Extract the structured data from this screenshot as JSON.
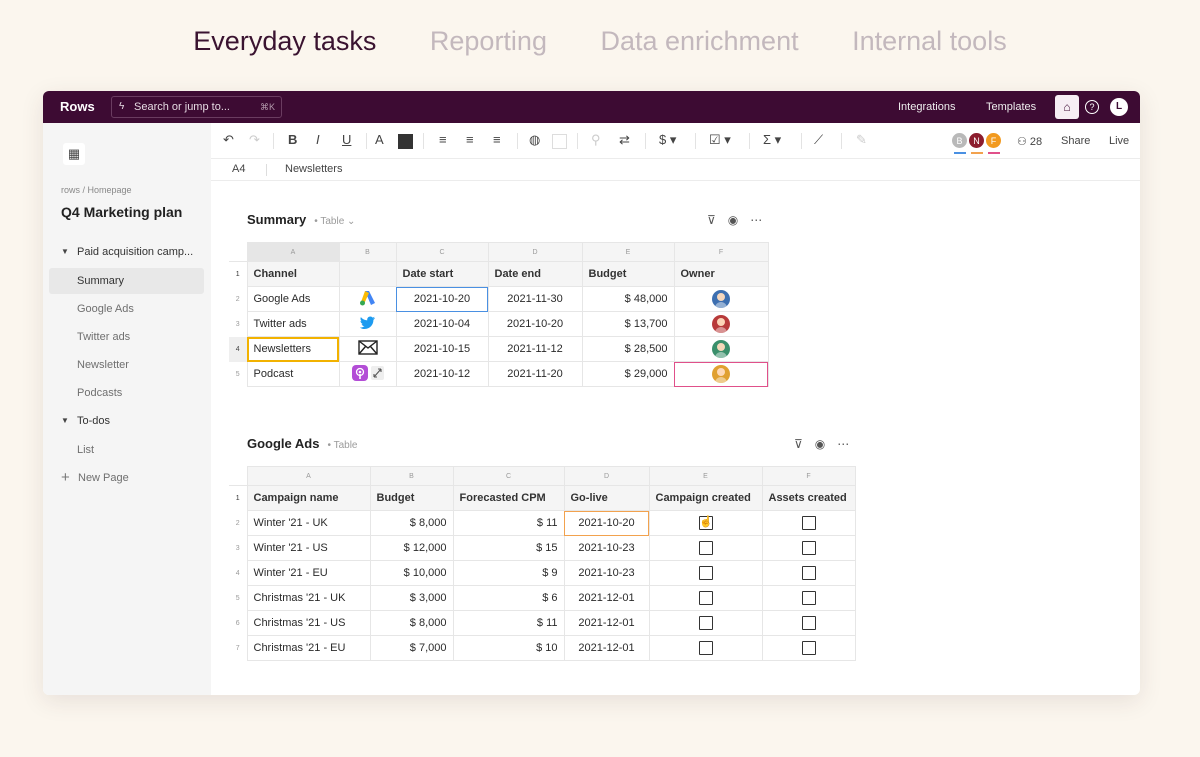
{
  "marketing_tabs": [
    {
      "label": "Everyday tasks",
      "active": true
    },
    {
      "label": "Reporting",
      "active": false
    },
    {
      "label": "Data enrichment",
      "active": false
    },
    {
      "label": "Internal tools",
      "active": false
    }
  ],
  "app": {
    "logo": "Rows",
    "search_placeholder": "Search or jump to...",
    "search_shortcut": "⌘K",
    "integrations": "Integrations",
    "templates": "Templates",
    "user_initial": "L"
  },
  "sidebar": {
    "breadcrumb": "rows / Homepage",
    "title": "Q4 Marketing plan",
    "groups": [
      {
        "label": "Paid acquisition camp...",
        "items": [
          "Summary",
          "Google Ads",
          "Twitter ads",
          "Newsletter",
          "Podcasts"
        ]
      },
      {
        "label": "To-dos",
        "items": [
          "List"
        ]
      }
    ],
    "new_page": "New Page"
  },
  "toolbar": {
    "collaborators": [
      {
        "initial": "B",
        "color": "#b9b9b9",
        "line": "#4a90e2"
      },
      {
        "initial": "N",
        "color": "#8c1d2e",
        "line": "#f2a24e"
      },
      {
        "initial": "F",
        "color": "#f29a1f",
        "line": "#e0508a"
      }
    ],
    "viewers": "28",
    "share": "Share",
    "live": "Live",
    "text_color": "#333333"
  },
  "formula_bar": {
    "ref": "A4",
    "value": "Newsletters"
  },
  "summary": {
    "title": "Summary",
    "kind": "Table",
    "letters": [
      "A",
      "B",
      "C",
      "D",
      "E",
      "F"
    ],
    "headers": [
      "Channel",
      "",
      "Date start",
      "Date end",
      "Budget",
      "Owner"
    ],
    "rows": [
      {
        "channel": "Google Ads",
        "icon": "google-ads-icon",
        "start": "2021-10-20",
        "end": "2021-11-30",
        "budget": "$ 48,000",
        "owner_color": "#3d6fb0"
      },
      {
        "channel": "Twitter ads",
        "icon": "twitter-icon",
        "start": "2021-10-04",
        "end": "2021-10-20",
        "budget": "$ 13,700",
        "owner_color": "#b83a3a"
      },
      {
        "channel": "Newsletters",
        "icon": "mail-icon",
        "start": "2021-10-15",
        "end": "2021-11-12",
        "budget": "$ 28,500",
        "owner_color": "#3a8f6b"
      },
      {
        "channel": "Podcast",
        "icon": "podcast-icon",
        "start": "2021-10-12",
        "end": "2021-11-20",
        "budget": "$ 29,000",
        "owner_color": "#e0a030"
      }
    ]
  },
  "google_ads": {
    "title": "Google Ads",
    "kind": "Table",
    "letters": [
      "A",
      "B",
      "C",
      "D",
      "E",
      "F"
    ],
    "headers": [
      "Campaign name",
      "Budget",
      "Forecasted CPM",
      "Go-live",
      "Campaign created",
      "Assets created"
    ],
    "rows": [
      {
        "name": "Winter '21 - UK",
        "budget": "$ 8,000",
        "cpm": "$ 11",
        "golive": "2021-10-20",
        "campaign": false,
        "assets": false
      },
      {
        "name": "Winter '21 - US",
        "budget": "$ 12,000",
        "cpm": "$ 15",
        "golive": "2021-10-23",
        "campaign": false,
        "assets": false
      },
      {
        "name": "Winter '21 - EU",
        "budget": "$ 10,000",
        "cpm": "$ 9",
        "golive": "2021-10-23",
        "campaign": false,
        "assets": false
      },
      {
        "name": "Christmas '21 - UK",
        "budget": "$ 3,000",
        "cpm": "$ 6",
        "golive": "2021-12-01",
        "campaign": false,
        "assets": false
      },
      {
        "name": "Christmas '21 - US",
        "budget": "$ 8,000",
        "cpm": "$ 11",
        "golive": "2021-12-01",
        "campaign": false,
        "assets": false
      },
      {
        "name": "Christmas '21 - EU",
        "budget": "$ 7,000",
        "cpm": "$ 10",
        "golive": "2021-12-01",
        "campaign": false,
        "assets": false
      }
    ]
  }
}
